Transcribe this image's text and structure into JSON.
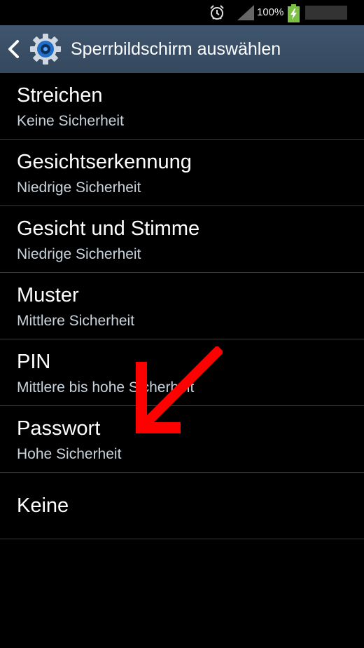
{
  "status_bar": {
    "battery_percent": "100%",
    "icons": [
      "alarm-icon",
      "signal-icon",
      "battery-charging-icon"
    ]
  },
  "header": {
    "title": "Sperrbildschirm auswählen",
    "icons": [
      "back-icon",
      "settings-gear-icon"
    ]
  },
  "items": [
    {
      "title": "Streichen",
      "subtitle": "Keine Sicherheit"
    },
    {
      "title": "Gesichtserkennung",
      "subtitle": "Niedrige Sicherheit"
    },
    {
      "title": "Gesicht und Stimme",
      "subtitle": "Niedrige Sicherheit"
    },
    {
      "title": "Muster",
      "subtitle": "Mittlere Sicherheit"
    },
    {
      "title": "PIN",
      "subtitle": "Mittlere bis hohe Sicherheit"
    },
    {
      "title": "Passwort",
      "subtitle": "Hohe Sicherheit"
    },
    {
      "title": "Keine"
    }
  ],
  "annotation": {
    "arrow_color": "#ff0000",
    "points_to": "Passwort"
  },
  "colors": {
    "background": "#000000",
    "action_bar": "#3a4f66",
    "subtitle": "#c9d3dc",
    "divider": "#3a3a3a"
  }
}
